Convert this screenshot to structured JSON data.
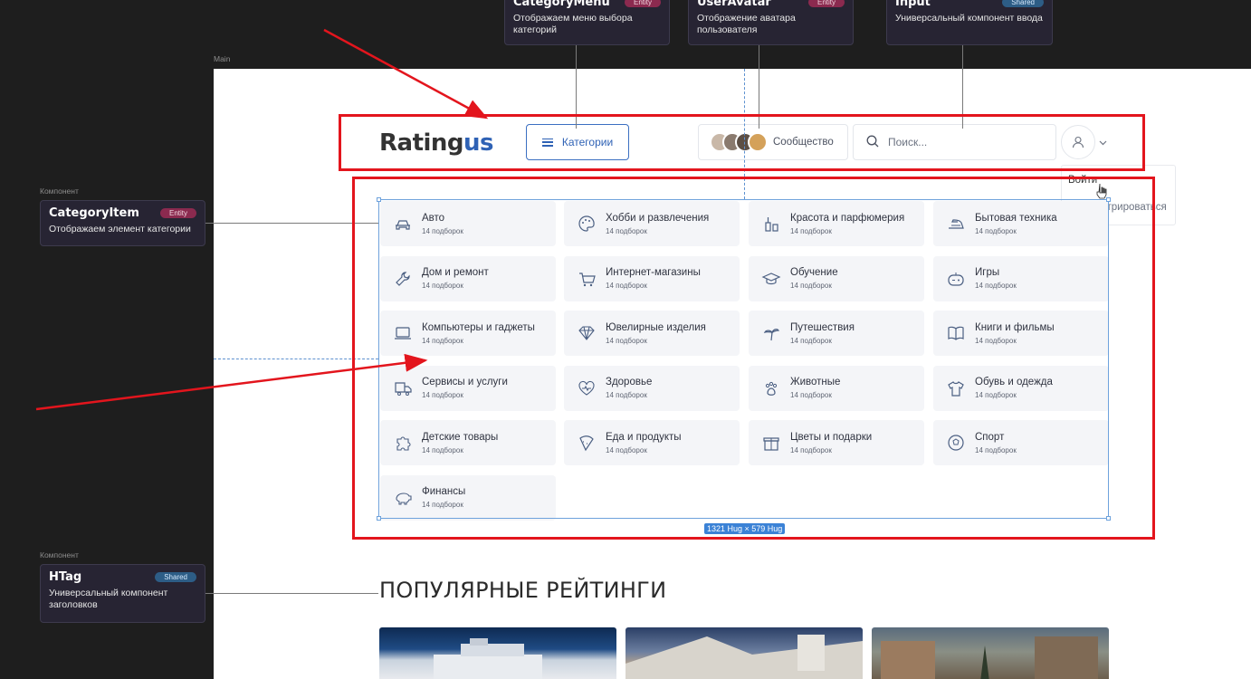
{
  "frame": {
    "label": "Main"
  },
  "annotations": {
    "top": [
      {
        "title": "CategoryMenu",
        "badge": "Entity",
        "desc": "Отображаем меню выбора категорий"
      },
      {
        "title": "UserAvatar",
        "badge": "Entity",
        "desc": "Отображение аватара пользователя"
      },
      {
        "title": "Input",
        "badge": "Shared",
        "desc": "Универсальный компонент ввода"
      }
    ],
    "left": [
      {
        "kicker": "Компонент",
        "title": "CategoryItem",
        "badge": "Entity",
        "desc": "Отображаем элемент категории"
      },
      {
        "kicker": "Компонент",
        "title": "HTag",
        "badge": "Shared",
        "desc": "Универсальный компонент заголовков"
      }
    ]
  },
  "header": {
    "logo_main": "Rating",
    "logo_accent": "us",
    "categories_label": "Категории",
    "community_label": "Сообщество",
    "search_placeholder": "Поиск...",
    "menu": {
      "login": "Войти",
      "register": "Зарегистрироваться"
    }
  },
  "categories": [
    {
      "name": "Авто",
      "count": "14 подборок",
      "icon": "car-icon"
    },
    {
      "name": "Хобби и развлечения",
      "count": "14 подборок",
      "icon": "palette-icon"
    },
    {
      "name": "Красота и парфюмерия",
      "count": "14 подборок",
      "icon": "perfume-icon"
    },
    {
      "name": "Бытовая техника",
      "count": "14 подборок",
      "icon": "iron-icon"
    },
    {
      "name": "Дом и ремонт",
      "count": "14 подборок",
      "icon": "wrench-icon"
    },
    {
      "name": "Интернет-магазины",
      "count": "14 подборок",
      "icon": "cart-icon"
    },
    {
      "name": "Обучение",
      "count": "14 подборок",
      "icon": "graduation-cap-icon"
    },
    {
      "name": "Игры",
      "count": "14 подборок",
      "icon": "gamepad-icon"
    },
    {
      "name": "Компьютеры и гаджеты",
      "count": "14 подборок",
      "icon": "laptop-icon"
    },
    {
      "name": "Ювелирные изделия",
      "count": "14 подборок",
      "icon": "diamond-icon"
    },
    {
      "name": "Путешествия",
      "count": "14 подборок",
      "icon": "palm-tree-icon"
    },
    {
      "name": "Книги и фильмы",
      "count": "14 подборок",
      "icon": "book-icon"
    },
    {
      "name": "Сервисы и услуги",
      "count": "14 подборок",
      "icon": "truck-icon"
    },
    {
      "name": "Здоровье",
      "count": "14 подборок",
      "icon": "heart-pulse-icon"
    },
    {
      "name": "Животные",
      "count": "14 подборок",
      "icon": "paw-icon"
    },
    {
      "name": "Обувь и одежда",
      "count": "14 подборок",
      "icon": "shirt-icon"
    },
    {
      "name": "Детские товары",
      "count": "14 подборок",
      "icon": "puzzle-icon"
    },
    {
      "name": "Еда и продукты",
      "count": "14 подборок",
      "icon": "pizza-icon"
    },
    {
      "name": "Цветы и подарки",
      "count": "14 подборок",
      "icon": "gift-icon"
    },
    {
      "name": "Спорт",
      "count": "14 подборок",
      "icon": "ball-icon"
    },
    {
      "name": "Финансы",
      "count": "14 подборок",
      "icon": "piggy-bank-icon"
    }
  ],
  "selection_size": "1321 Hug × 579 Hug",
  "popular_heading": "ПОПУЛЯРНЫЕ РЕЙТИНГИ",
  "colors": {
    "accent": "#2f62b5",
    "highlight": "#e3151d",
    "entity": "#8b2a4f",
    "shared": "#2d5d86"
  }
}
